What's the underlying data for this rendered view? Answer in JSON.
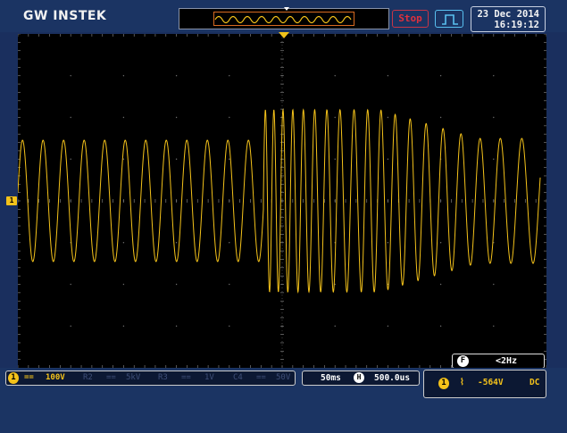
{
  "header": {
    "brand": "GW INSTEK",
    "run_state": "Stop",
    "date": "23 Dec 2014",
    "time": "16:19:12"
  },
  "channel1": {
    "marker": "1",
    "coupling_symbol": "==",
    "volts_per_div": "100V",
    "color": "#f4c21a"
  },
  "inactive_channels": [
    {
      "name": "R2",
      "sep": "==",
      "value": "5kV"
    },
    {
      "name": "R3",
      "sep": "==",
      "value": "1V"
    },
    {
      "name": "C4",
      "sep": "==",
      "value": "50V"
    }
  ],
  "timebase": {
    "time_per_div": "50ms",
    "h_icon": "H",
    "position": "500.0us"
  },
  "trigger": {
    "channel": "1",
    "slope_symbol": "⌇",
    "level": "-564V",
    "coupling": "DC"
  },
  "frequency": {
    "icon": "F",
    "value": "<2Hz"
  },
  "colors": {
    "trace": "#f4c21a",
    "stop": "#e0303c",
    "chrome": "#1b3463"
  }
}
